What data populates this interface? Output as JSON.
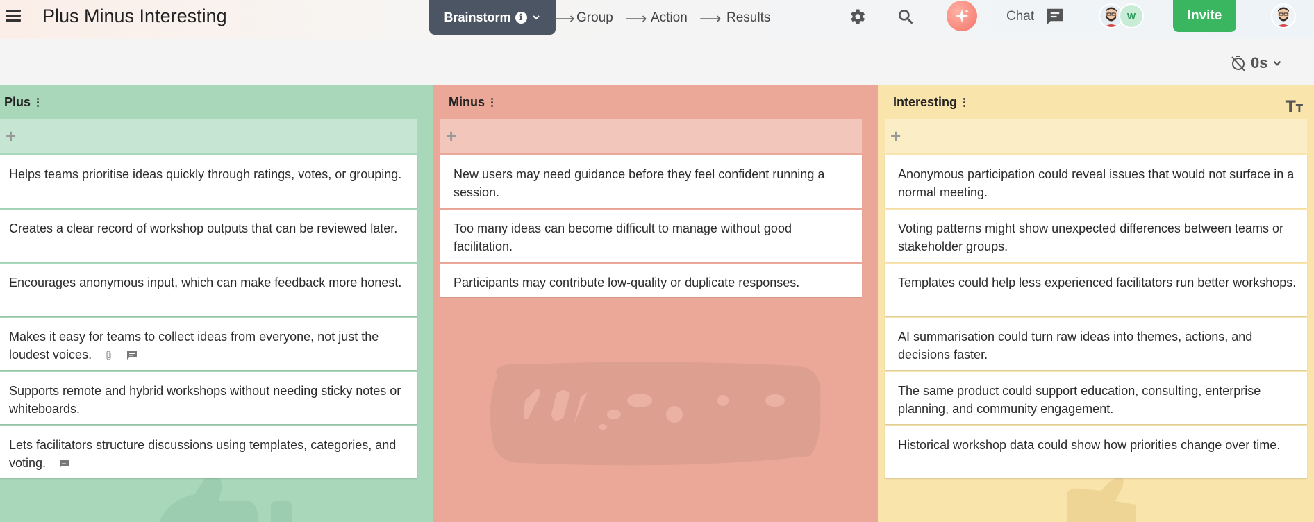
{
  "header": {
    "app_title": "Plus Minus Interesting",
    "stage": {
      "label": "Brainstorm",
      "info": "i"
    },
    "steps": [
      "Group",
      "Action",
      "Results"
    ],
    "chat_label": "Chat",
    "collaborator_initial": "W",
    "invite_label": "Invite"
  },
  "timer": {
    "value": "0s"
  },
  "columns": [
    {
      "title": "Plus",
      "color": "#a9d7ba",
      "cards": [
        "Helps teams prioritise ideas quickly through ratings, votes, or grouping.",
        "Creates a clear record of workshop outputs that can be reviewed later.",
        "Encourages anonymous input, which can make feedback more honest.",
        "Makes it easy for teams to collect ideas from everyone, not just the loudest voices.",
        "Supports remote and hybrid workshops without needing sticky notes or whiteboards.",
        "Lets facilitators structure discussions using templates, categories, and voting."
      ]
    },
    {
      "title": "Minus",
      "color": "#eba898",
      "cards": [
        "New users may need guidance before they feel confident running a session.",
        "Too many ideas can become difficult to manage without good facilitation.",
        "Participants may contribute low-quality or duplicate responses."
      ]
    },
    {
      "title": "Interesting",
      "color": "#f9e4ab",
      "cards": [
        "Anonymous participation could reveal issues that would not surface in a normal meeting.",
        "Voting patterns might show unexpected differences between teams or stakeholder groups.",
        "Templates could help less experienced facilitators run better workshops.",
        "AI summarisation could turn raw ideas into themes, actions, and decisions faster.",
        "The same product could support education, consulting, enterprise planning, and community engagement.",
        "Historical workshop data could show how priorities change over time."
      ]
    }
  ],
  "add_symbol": "+",
  "text_size_label": {
    "big": "T",
    "small": "T"
  }
}
